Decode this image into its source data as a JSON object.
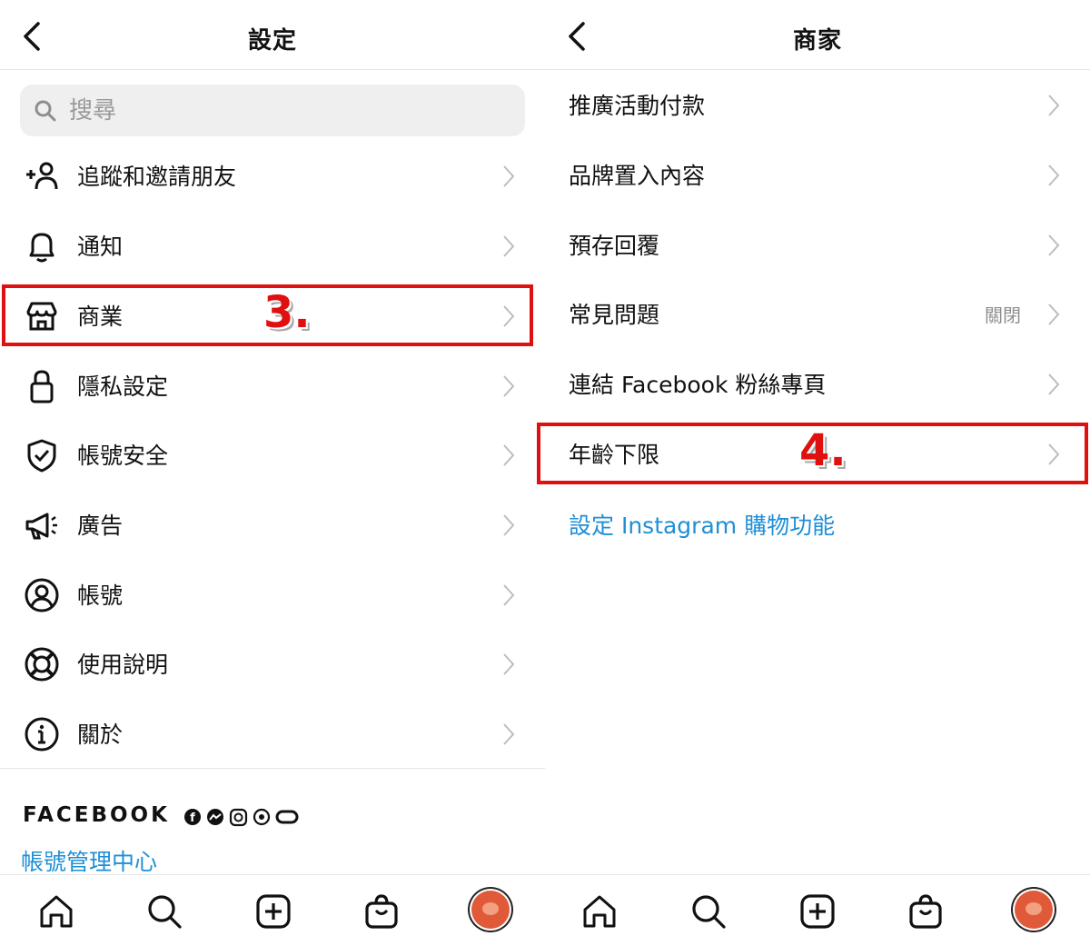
{
  "left": {
    "title": "設定",
    "search_placeholder": "搜尋",
    "items": [
      {
        "label": "追蹤和邀請朋友",
        "icon": "add-person-icon"
      },
      {
        "label": "通知",
        "icon": "bell-icon"
      },
      {
        "label": "商業",
        "icon": "shop-icon"
      },
      {
        "label": "隱私設定",
        "icon": "lock-icon"
      },
      {
        "label": "帳號安全",
        "icon": "shield-check-icon"
      },
      {
        "label": "廣告",
        "icon": "megaphone-icon"
      },
      {
        "label": "帳號",
        "icon": "user-circle-icon"
      },
      {
        "label": "使用說明",
        "icon": "lifebuoy-icon"
      },
      {
        "label": "關於",
        "icon": "info-icon"
      }
    ],
    "facebook_brand": "FACEBOOK",
    "accounts_center_link": "帳號管理中心",
    "step_annotation": "3."
  },
  "right": {
    "title": "商家",
    "items": [
      {
        "label": "推廣活動付款",
        "status": ""
      },
      {
        "label": "品牌置入內容",
        "status": ""
      },
      {
        "label": "預存回覆",
        "status": ""
      },
      {
        "label": "常見問題",
        "status": "關閉"
      },
      {
        "label": "連結 Facebook 粉絲專頁",
        "status": ""
      },
      {
        "label": "年齡下限",
        "status": ""
      }
    ],
    "shopping_link": "設定 Instagram 購物功能",
    "step_annotation": "4."
  },
  "tabbar": [
    "home-icon",
    "search-icon",
    "new-post-icon",
    "shop-bag-icon",
    "profile-avatar"
  ],
  "colors": {
    "highlight": "#e01010",
    "link": "#1f8fd6",
    "muted": "#8e8e8e"
  }
}
